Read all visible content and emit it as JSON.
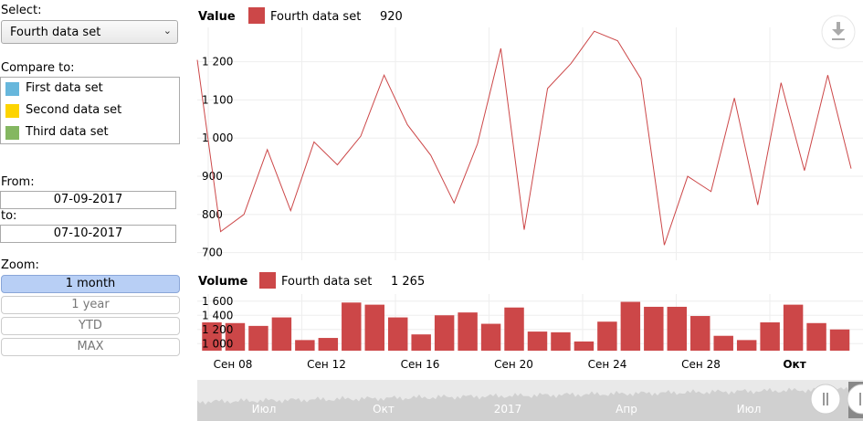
{
  "sidebar": {
    "select_label": "Select:",
    "selected_set": "Fourth data set",
    "compare_label": "Compare to:",
    "compare_items": [
      {
        "label": "First data set",
        "color": "#67b7dc"
      },
      {
        "label": "Second data set",
        "color": "#fdd400"
      },
      {
        "label": "Third data set",
        "color": "#84b761"
      }
    ],
    "from_label": "From:",
    "from_value": "07-09-2017",
    "to_label": "to:",
    "to_value": "07-10-2017",
    "zoom_label": "Zoom:",
    "zoom_options": [
      "1 month",
      "1 year",
      "YTD",
      "MAX"
    ],
    "zoom_active": 0
  },
  "chart_data": [
    {
      "type": "line",
      "title": "Value",
      "series": [
        {
          "name": "Fourth data set",
          "color": "#cc4748",
          "values": [
            1205,
            755,
            800,
            970,
            810,
            990,
            930,
            1005,
            1165,
            1035,
            955,
            830,
            985,
            1235,
            760,
            1130,
            1195,
            1280,
            1255,
            1155,
            720,
            900,
            860,
            1105,
            825,
            1145,
            915,
            1165,
            920
          ]
        }
      ],
      "legend_value": "920",
      "yticks": [
        "1 200",
        "1 100",
        "1 000",
        "900",
        "800",
        "700"
      ],
      "ylim": [
        680,
        1290
      ]
    },
    {
      "type": "bar",
      "title": "Volume",
      "series": [
        {
          "name": "Fourth data set",
          "color": "#cc4748",
          "values": [
            1300,
            1290,
            1250,
            1370,
            1050,
            1080,
            1580,
            1550,
            1370,
            1130,
            1400,
            1440,
            1280,
            1510,
            1170,
            1160,
            1030,
            1310,
            1590,
            1520,
            1520,
            1390,
            1110,
            1050,
            1300,
            1550,
            1290,
            1200
          ]
        }
      ],
      "legend_value": "1 265",
      "yticks": [
        "1 600",
        "1 400",
        "1 200",
        "1 000"
      ],
      "ylim": [
        900,
        1700
      ]
    }
  ],
  "x_axis_labels": [
    "Сен 08",
    "Сен 12",
    "Сен 16",
    "Сен 20",
    "Сен 24",
    "Сен 28",
    "Окт"
  ],
  "scrollbar_labels": [
    "Июл",
    "Окт",
    "2017",
    "Апр",
    "Июл"
  ],
  "export_icon": "download-icon"
}
